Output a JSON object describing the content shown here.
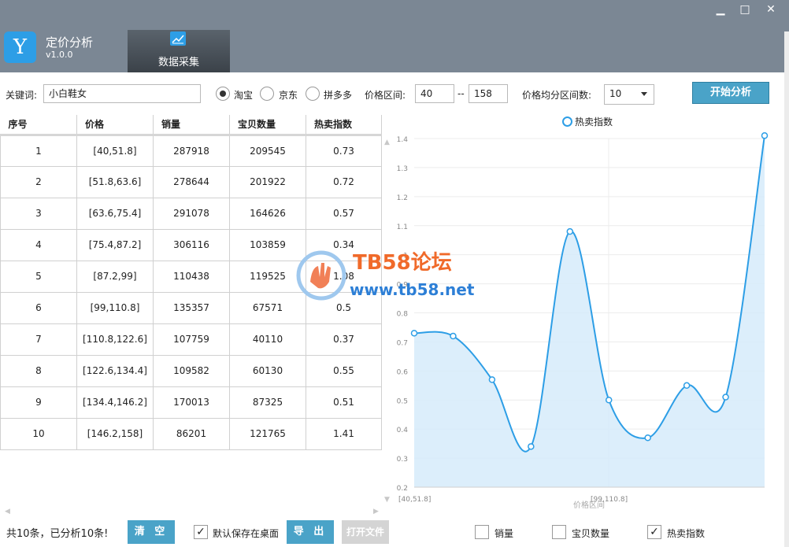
{
  "app": {
    "icon_glyph": "Y",
    "title": "定价分析",
    "version": "v1.0.0",
    "accent": "#2d9ee6"
  },
  "tabs": [
    {
      "label": "数据采集",
      "icon": "chart-icon"
    }
  ],
  "window_controls": {
    "minimize": "▁",
    "maximize": "□",
    "close": "✕"
  },
  "search": {
    "keyword_label": "关键词:",
    "keyword_value": "小白鞋女",
    "platforms": [
      {
        "label": "淘宝",
        "selected": true
      },
      {
        "label": "京东",
        "selected": false
      },
      {
        "label": "拼多多",
        "selected": false
      }
    ],
    "price_range_label": "价格区间:",
    "price_min": "40",
    "price_sep": "--",
    "price_max": "158",
    "intervals_label": "价格均分区间数:",
    "intervals_value": "10",
    "start_button": "开始分析"
  },
  "table": {
    "columns": [
      "序号",
      "价格",
      "销量",
      "宝贝数量",
      "热卖指数"
    ],
    "rows": [
      [
        "1",
        "[40,51.8]",
        "287918",
        "209545",
        "0.73"
      ],
      [
        "2",
        "[51.8,63.6]",
        "278644",
        "201922",
        "0.72"
      ],
      [
        "3",
        "[63.6,75.4]",
        "291078",
        "164626",
        "0.57"
      ],
      [
        "4",
        "[75.4,87.2]",
        "306116",
        "103859",
        "0.34"
      ],
      [
        "5",
        "[87.2,99]",
        "110438",
        "119525",
        "1.08"
      ],
      [
        "6",
        "[99,110.8]",
        "135357",
        "67571",
        "0.5"
      ],
      [
        "7",
        "[110.8,122.6]",
        "107759",
        "40110",
        "0.37"
      ],
      [
        "8",
        "[122.6,134.4]",
        "109582",
        "60130",
        "0.55"
      ],
      [
        "9",
        "[134.4,146.2]",
        "170013",
        "87325",
        "0.51"
      ],
      [
        "10",
        "[146.2,158]",
        "86201",
        "121765",
        "1.41"
      ]
    ]
  },
  "chart_data": {
    "type": "area",
    "legend": [
      "热卖指数"
    ],
    "series": [
      {
        "name": "热卖指数",
        "values": [
          0.73,
          0.72,
          0.57,
          0.34,
          1.08,
          0.5,
          0.37,
          0.55,
          0.51,
          1.41
        ]
      }
    ],
    "categories": [
      "[40,51.8]",
      "[51.8,63.6]",
      "[63.6,75.4]",
      "[75.4,87.2]",
      "[87.2,99]",
      "[99,110.8]",
      "[110.8,122.6]",
      "[122.6,134.4]",
      "[134.4,146.2]",
      "[146.2,158]"
    ],
    "x_tick_labels": [
      "[40,51.8]",
      "[99,110.8]"
    ],
    "xlabel": "价格区间",
    "ylabel": "",
    "ylim": [
      0.2,
      1.4
    ],
    "yticks": [
      "0.2",
      "0.3",
      "0.4",
      "0.5",
      "0.6",
      "0.7",
      "0.8",
      "0.9",
      "1",
      "1.1",
      "1.2",
      "1.3",
      "1.4"
    ],
    "line_color": "#2d9ee6",
    "fill_color": "#d6ebfa",
    "grid": true,
    "legend_position": "top"
  },
  "watermark": {
    "line1": "TB58论坛",
    "line2": "www.tb58.net"
  },
  "footer": {
    "summary": "共10条，已分析10条!",
    "clear_button": "清 空",
    "save_default_label": "默认保存在桌面",
    "save_default_checked": true,
    "export_button": "导 出",
    "open_file_button": "打开文件",
    "series_toggles": [
      {
        "label": "销量",
        "checked": false
      },
      {
        "label": "宝贝数量",
        "checked": false
      },
      {
        "label": "热卖指数",
        "checked": true
      }
    ]
  }
}
